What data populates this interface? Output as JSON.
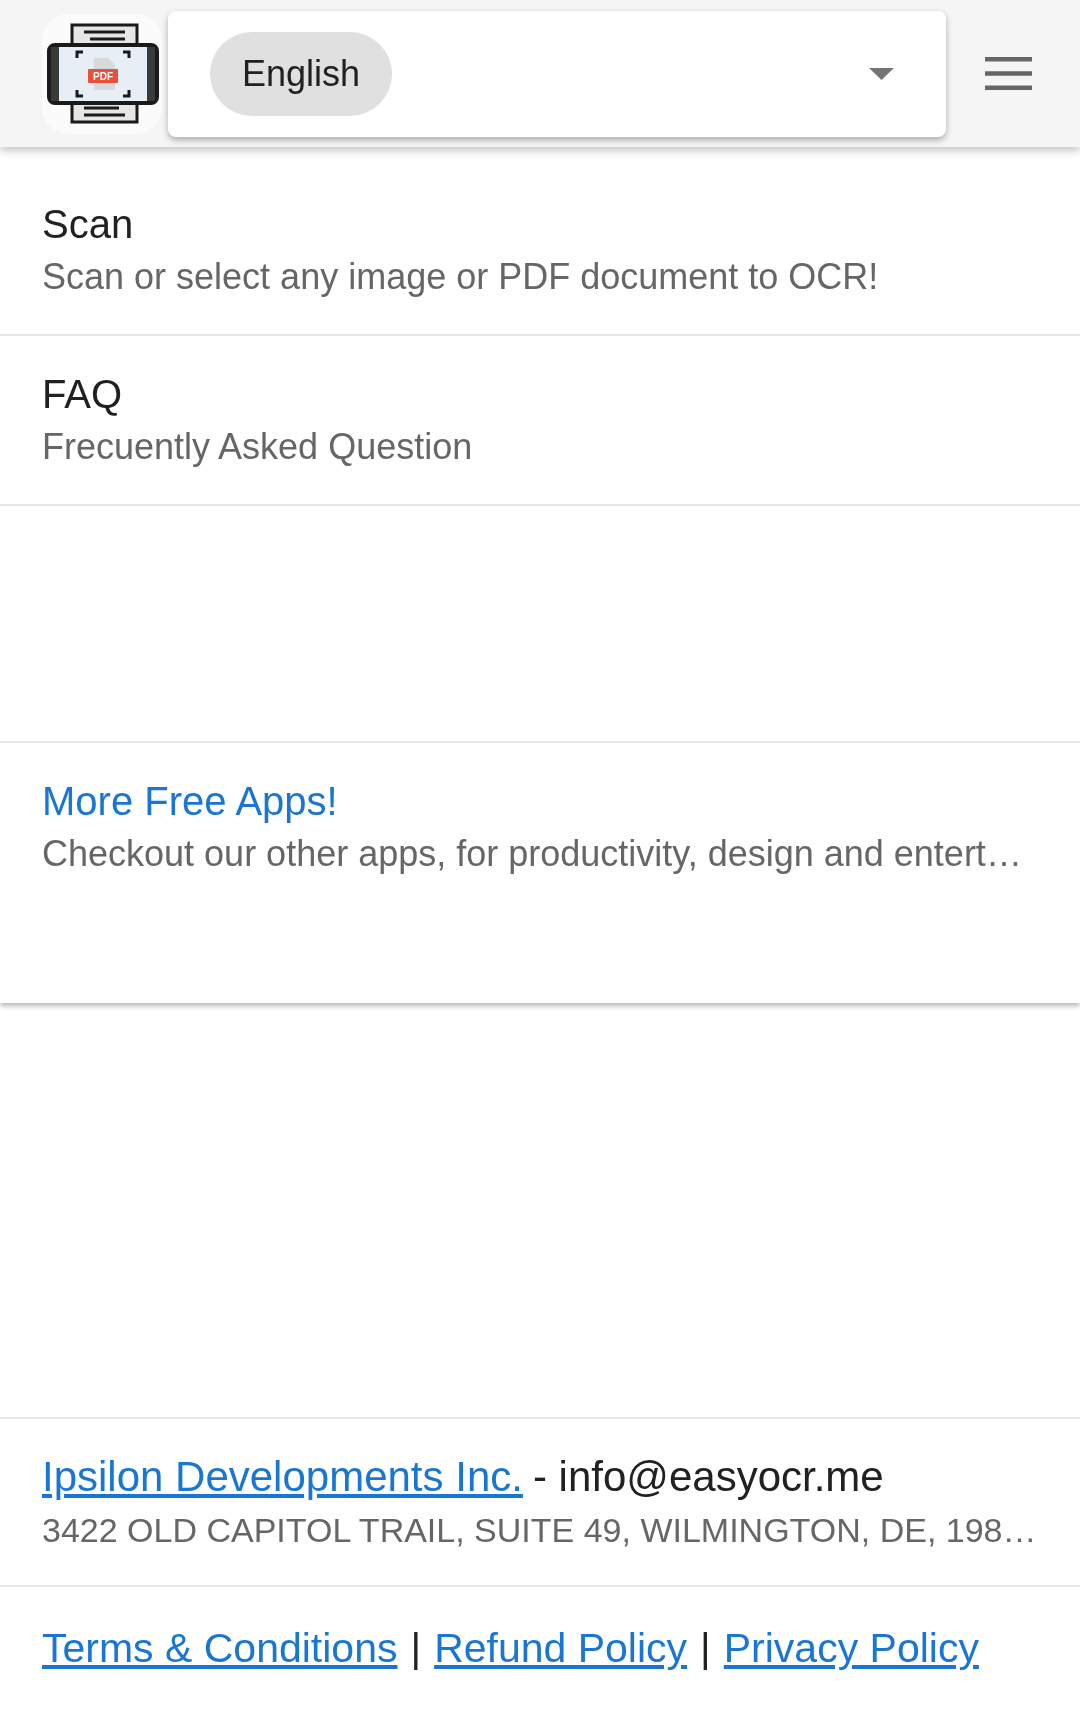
{
  "header": {
    "logo": {
      "label": "PDF"
    },
    "language_select": {
      "value": "English"
    }
  },
  "menu": {
    "items": [
      {
        "title": "Scan",
        "subtitle": "Scan or select any image or PDF document to OCR!"
      },
      {
        "title": "FAQ",
        "subtitle": "Frecuently Asked Question"
      }
    ]
  },
  "promo": {
    "title": "More Free Apps!",
    "subtitle": "Checkout our other apps, for productivity, design and entert…"
  },
  "footer": {
    "company": "Ipsilon Developments Inc.",
    "contact": "- info@easyocr.me",
    "address": "3422 OLD CAPITOL TRAIL, SUITE 49, WILMINGTON, DE, 198…",
    "legal": [
      {
        "kind": "link",
        "label": "Terms & Conditions"
      },
      {
        "kind": "separator",
        "label": "|"
      },
      {
        "kind": "link",
        "label": "Refund Policy"
      },
      {
        "kind": "separator",
        "label": "|"
      },
      {
        "kind": "link",
        "label": "Privacy Policy"
      }
    ]
  }
}
